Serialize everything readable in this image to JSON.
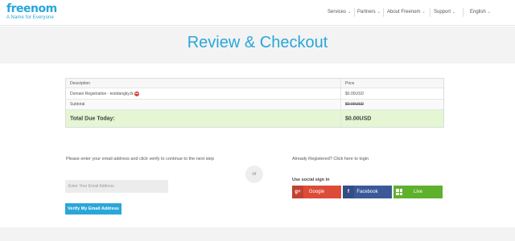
{
  "header": {
    "logo_word": "freenom",
    "logo_tagline": "A Name for Everyone",
    "nav": [
      {
        "label": "Services"
      },
      {
        "label": "Partners"
      },
      {
        "label": "About Freenom"
      },
      {
        "label": "Support"
      },
      {
        "label": "English"
      }
    ]
  },
  "hero": {
    "title": "Review & Checkout"
  },
  "table": {
    "headers": {
      "description": "Description",
      "price": "Price"
    },
    "item": {
      "description": "Domain Registration - testdangky.tk",
      "price": "$0.00USD"
    },
    "subtotal": {
      "label": "Subtotal",
      "value": "$0.00USD"
    },
    "total": {
      "label": "Total Due Today:",
      "value": "$0.00USD"
    }
  },
  "email": {
    "instructions": "Please enter your email address and click verify to continue to the next step",
    "placeholder": "Enter Your Email Address",
    "verify_label": "Verify My Email Address"
  },
  "or_label": "or",
  "social": {
    "already_registered": "Already Registered? Click here to login",
    "label": "Use social sign in",
    "buttons": [
      {
        "label": "Google",
        "color": "#dd4b39",
        "icon": "google-plus-icon"
      },
      {
        "label": "Facebook",
        "color": "#3b5998",
        "icon": "facebook-icon"
      },
      {
        "label": "Live",
        "color": "#5fb12c",
        "icon": "windows-icon"
      }
    ]
  },
  "colors": {
    "brand": "#2aa6d9",
    "total_bg": "#e4f6d4"
  }
}
